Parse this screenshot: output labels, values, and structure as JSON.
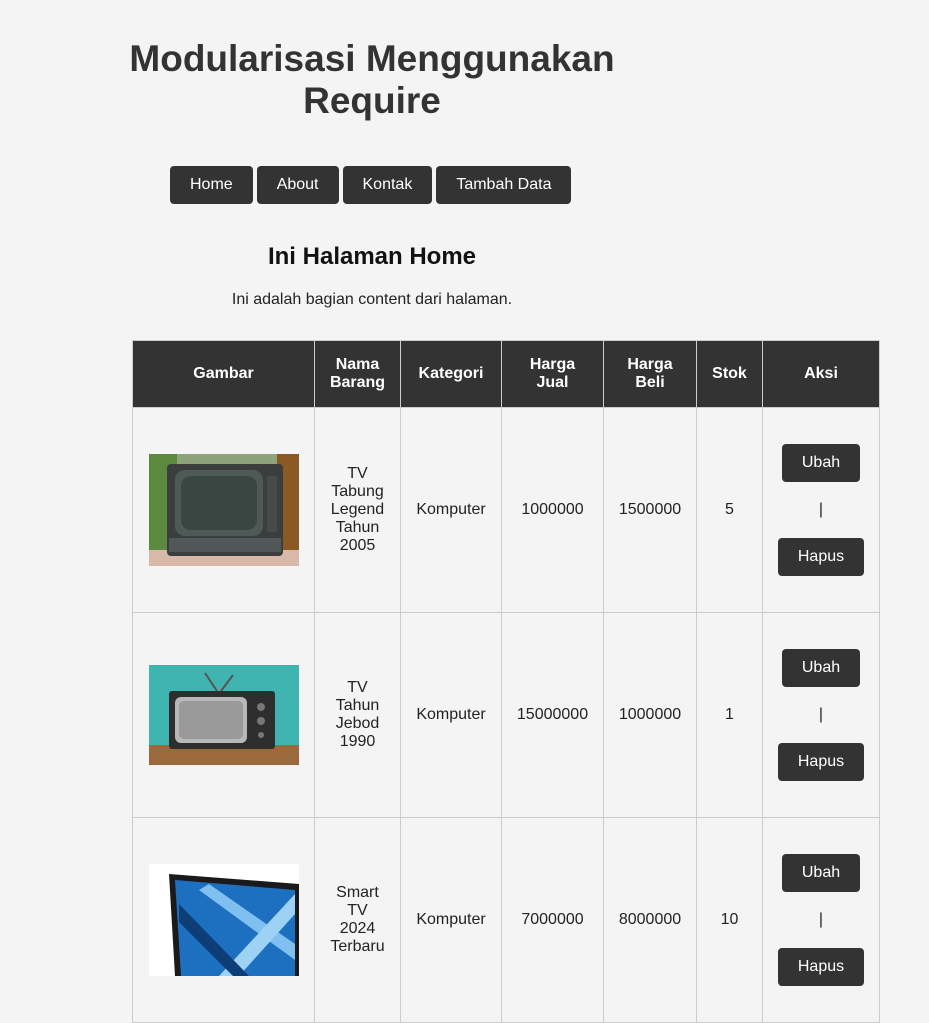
{
  "header": {
    "title_line1": "Modularisasi Menggunakan",
    "title_line2": "Require"
  },
  "nav": {
    "items": [
      "Home",
      "About",
      "Kontak",
      "Tambah Data"
    ]
  },
  "content": {
    "heading": "Ini Halaman Home",
    "text": "Ini adalah bagian content dari halaman."
  },
  "table": {
    "headers": {
      "gambar": "Gambar",
      "nama_1": "Nama",
      "nama_2": "Barang",
      "kategori": "Kategori",
      "jual_1": "Harga",
      "jual_2": "Jual",
      "beli_1": "Harga",
      "beli_2": "Beli",
      "stok": "Stok",
      "aksi": "Aksi"
    },
    "rows": [
      {
        "image_icon": "crt-tv-image",
        "name_lines": [
          "TV",
          "Tabung",
          "Legend",
          "Tahun",
          "2005"
        ],
        "kategori": "Komputer",
        "harga_jual": "1000000",
        "harga_beli": "1500000",
        "stok": "5",
        "ubah": "Ubah",
        "separator": "|",
        "hapus": "Hapus"
      },
      {
        "image_icon": "retro-tv-image",
        "name_lines": [
          "TV",
          "Tahun",
          "Jebod",
          "1990"
        ],
        "kategori": "Komputer",
        "harga_jual": "15000000",
        "harga_beli": "1000000",
        "stok": "1",
        "ubah": "Ubah",
        "separator": "|",
        "hapus": "Hapus"
      },
      {
        "image_icon": "smart-tv-image",
        "name_lines": [
          "Smart",
          "TV",
          "2024",
          "Terbaru"
        ],
        "kategori": "Komputer",
        "harga_jual": "7000000",
        "harga_beli": "8000000",
        "stok": "10",
        "ubah": "Ubah",
        "separator": "|",
        "hapus": "Hapus"
      }
    ]
  }
}
